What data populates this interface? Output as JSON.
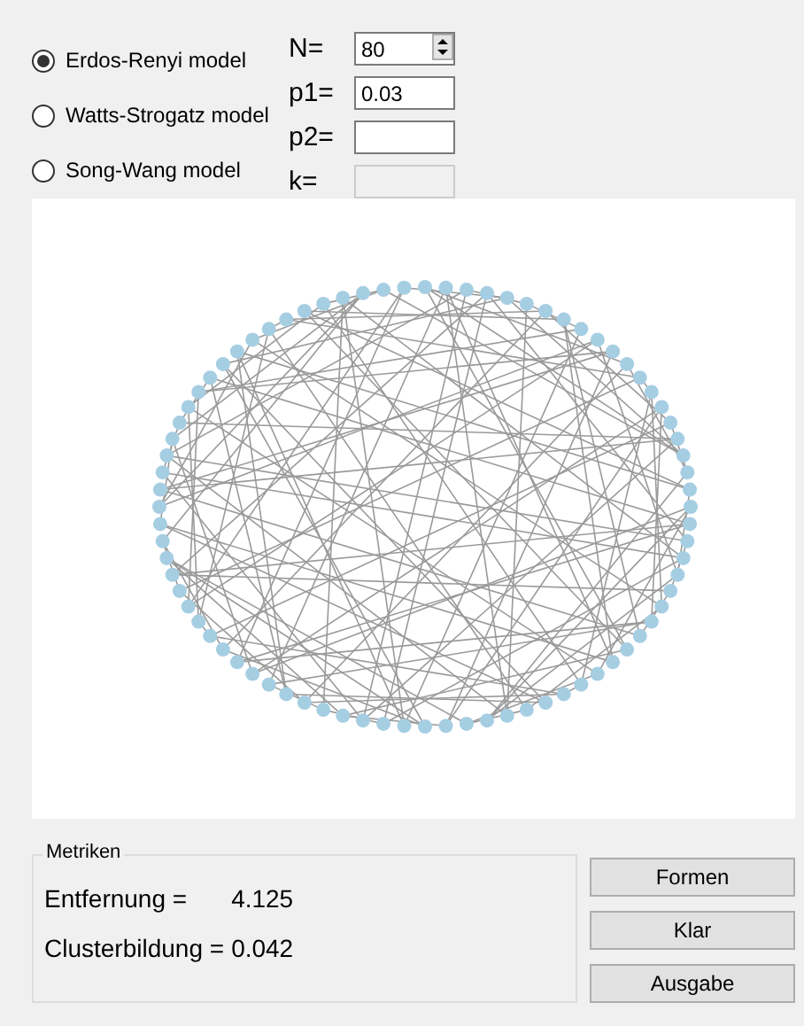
{
  "models": [
    {
      "label": "Erdos-Renyi model",
      "selected": true
    },
    {
      "label": "Watts-Strogatz model",
      "selected": false
    },
    {
      "label": "Song-Wang model",
      "selected": false
    }
  ],
  "params": [
    {
      "label": "N=",
      "value": "80",
      "kind": "spin",
      "disabled": false
    },
    {
      "label": "p1=",
      "value": "0.03",
      "kind": "text",
      "disabled": false
    },
    {
      "label": "p2=",
      "kind": "text",
      "disabled": false
    },
    {
      "label": "k=",
      "kind": "text",
      "disabled": true
    }
  ],
  "metrics": {
    "title": "Metriken",
    "rows": [
      {
        "label": "Entfernung =",
        "value": "4.125"
      },
      {
        "label": "Clusterbildung =",
        "value": "0.042"
      }
    ]
  },
  "buttons": [
    "Formen",
    "Klar",
    "Ausgabe"
  ]
}
